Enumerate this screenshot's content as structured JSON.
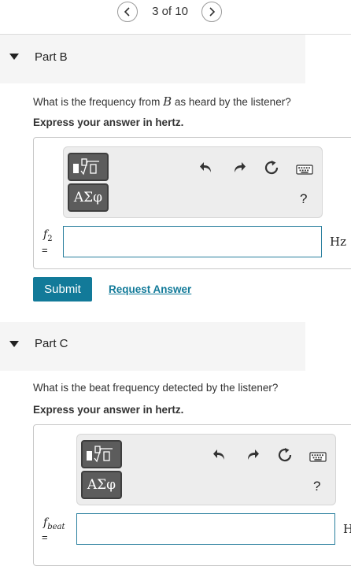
{
  "pager": {
    "text": "3 of 10",
    "prev_icon": "chevron-left-icon",
    "next_icon": "chevron-right-icon"
  },
  "partB": {
    "title": "Part B",
    "question_before": "What is the frequency from ",
    "question_var": "B",
    "question_after": " as heard by the listener?",
    "instruction": "Express your answer in hertz.",
    "toolbar": {
      "templates_icon": "templates-icon",
      "greek_label": "ΑΣφ",
      "help_label": "?"
    },
    "variable": "f",
    "variable_sub": "2",
    "equals": "=",
    "input_value": "",
    "unit": "Hz",
    "submit_label": "Submit",
    "request_label": "Request Answer"
  },
  "partC": {
    "title": "Part C",
    "question": "What is the beat frequency detected by the listener?",
    "instruction": "Express your answer in hertz.",
    "toolbar": {
      "templates_icon": "templates-icon",
      "greek_label": "ΑΣφ",
      "help_label": "?"
    },
    "variable": "f",
    "variable_sub": "beat",
    "equals": "=",
    "input_value": "",
    "unit": "H"
  },
  "colors": {
    "accent": "#127a99",
    "input_border": "#2a7f9e",
    "header_bg": "#f5f5f5",
    "toolbar_bg": "#ededed"
  }
}
